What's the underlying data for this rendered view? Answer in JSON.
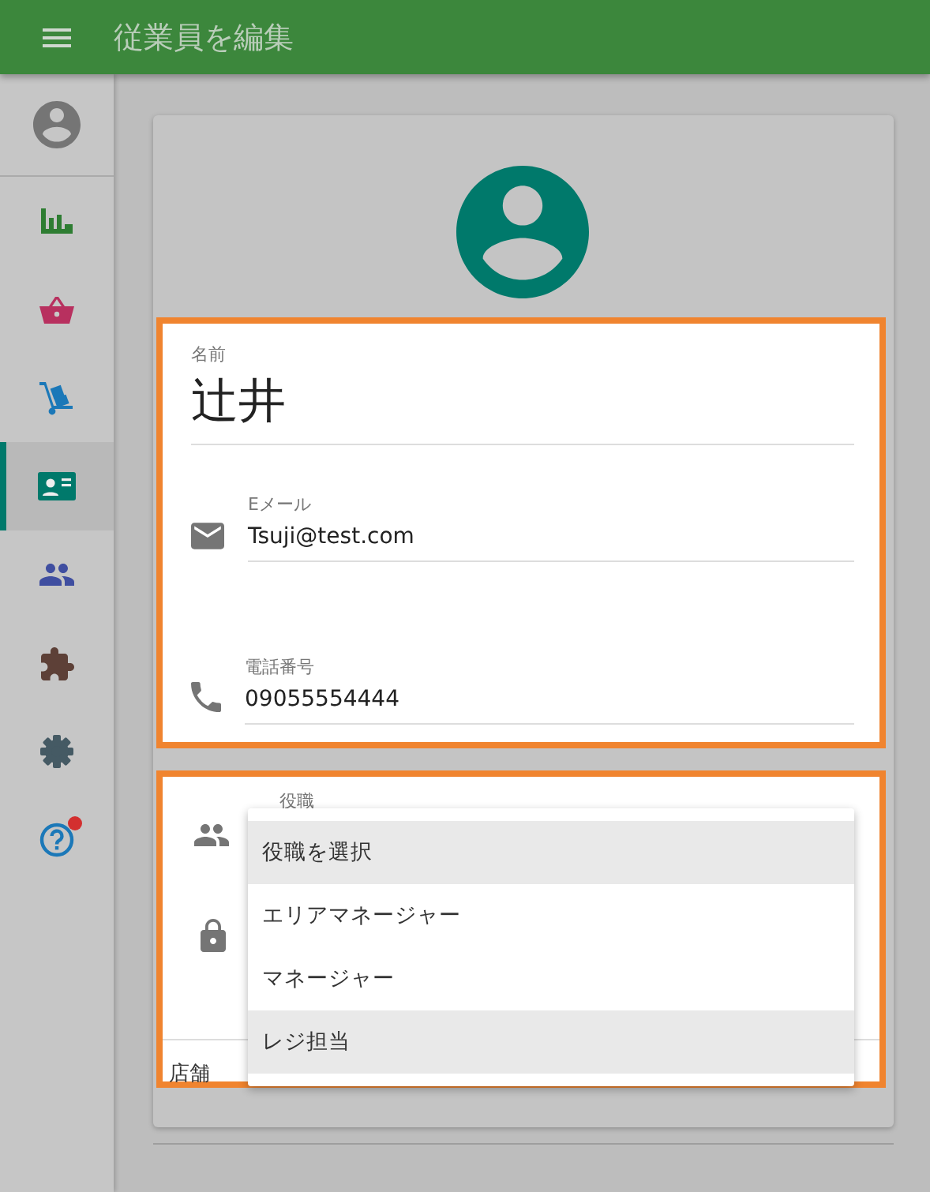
{
  "app_bar": {
    "title": "従業員を編集"
  },
  "sidebar": {
    "items": [
      {
        "kind": "chart",
        "color": "#2e7d32",
        "selected": false
      },
      {
        "kind": "basket",
        "color": "#b8305f",
        "selected": false
      },
      {
        "kind": "cart",
        "color": "#1b78b8",
        "selected": false
      },
      {
        "kind": "badge",
        "color": "#00796b",
        "selected": true
      },
      {
        "kind": "people",
        "color": "#3f4ea0",
        "selected": false
      },
      {
        "kind": "puzzle",
        "color": "#5d4037",
        "selected": false
      },
      {
        "kind": "gear",
        "color": "#455a64",
        "selected": false
      },
      {
        "kind": "help",
        "color": "#1b78b8",
        "selected": false,
        "notification": true
      }
    ]
  },
  "form": {
    "name": {
      "label": "名前",
      "value": "辻井"
    },
    "email": {
      "label": "Eメール",
      "value": "Tsuji@test.com"
    },
    "phone": {
      "label": "電話番号",
      "value": "09055554444"
    },
    "role": {
      "label": "役職"
    },
    "role_menu": {
      "items": [
        {
          "label": "役職を選択",
          "highlighted": true
        },
        {
          "label": "エリアマネージャー",
          "highlighted": false
        },
        {
          "label": "マネージャー",
          "highlighted": false
        },
        {
          "label": "レジ担当",
          "highlighted": true
        }
      ]
    },
    "store": {
      "label": "店舗"
    }
  }
}
